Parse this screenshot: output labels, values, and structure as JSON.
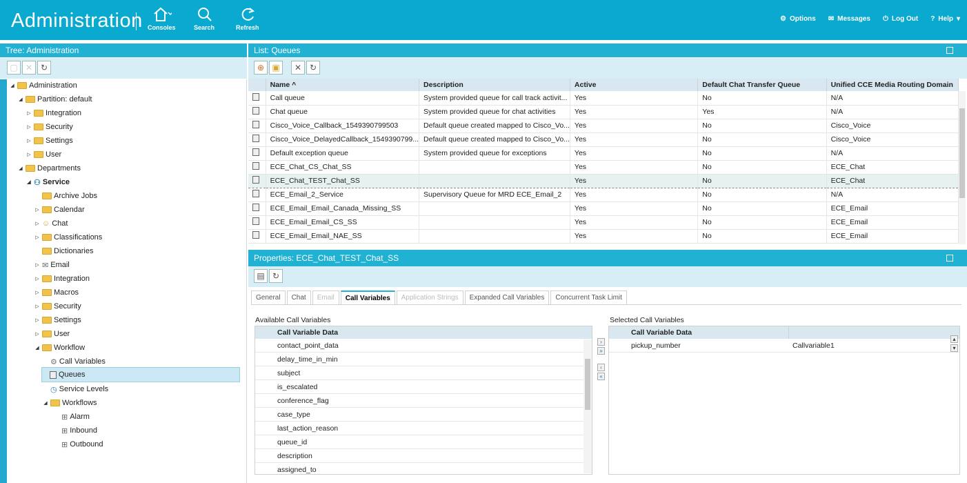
{
  "header": {
    "title": "Administration",
    "consoles": "Consoles",
    "search": "Search",
    "refresh": "Refresh",
    "options": "Options",
    "messages": "Messages",
    "logout": "Log Out",
    "help": "Help"
  },
  "tree": {
    "title": "Tree: Administration",
    "items": [
      "Administration",
      "Partition: default",
      "Integration",
      "Security",
      "Settings",
      "User",
      "Departments",
      "Service",
      "Archive Jobs",
      "Calendar",
      "Chat",
      "Classifications",
      "Dictionaries",
      "Email",
      "Integration",
      "Macros",
      "Security",
      "Settings",
      "User",
      "Workflow",
      "Call Variables",
      "Queues",
      "Service Levels",
      "Workflows",
      "Alarm",
      "Inbound",
      "Outbound"
    ]
  },
  "list": {
    "title": "List: Queues",
    "columns": [
      "Name ^",
      "Description",
      "Active",
      "Default Chat Transfer Queue",
      "Unified CCE Media Routing Domain"
    ],
    "rows": [
      [
        "Call queue",
        "System provided queue for call track activit...",
        "Yes",
        "No",
        "N/A"
      ],
      [
        "Chat queue",
        "System provided queue for chat activities",
        "Yes",
        "Yes",
        "N/A"
      ],
      [
        "Cisco_Voice_Callback_1549390799503",
        "Default queue created mapped to Cisco_Vo...",
        "Yes",
        "No",
        "Cisco_Voice"
      ],
      [
        "Cisco_Voice_DelayedCallback_1549390799...",
        "Default queue created mapped to Cisco_Vo...",
        "Yes",
        "No",
        "Cisco_Voice"
      ],
      [
        "Default exception queue",
        "System provided queue for exceptions",
        "Yes",
        "No",
        "N/A"
      ],
      [
        "ECE_Chat_CS_Chat_SS",
        "",
        "Yes",
        "No",
        "ECE_Chat"
      ],
      [
        "ECE_Chat_TEST_Chat_SS",
        "",
        "Yes",
        "No",
        "ECE_Chat"
      ],
      [
        "ECE_Email_2_Service",
        "Supervisory Queue for MRD ECE_Email_2",
        "Yes",
        "No",
        "N/A"
      ],
      [
        "ECE_Email_Email_Canada_Missing_SS",
        "",
        "Yes",
        "No",
        "ECE_Email"
      ],
      [
        "ECE_Email_Email_CS_SS",
        "",
        "Yes",
        "No",
        "ECE_Email"
      ],
      [
        "ECE_Email_Email_NAE_SS",
        "",
        "Yes",
        "No",
        "ECE_Email"
      ]
    ]
  },
  "props": {
    "title": "Properties: ECE_Chat_TEST_Chat_SS",
    "tabs": [
      "General",
      "Chat",
      "Email",
      "Call Variables",
      "Application Strings",
      "Expanded Call Variables",
      "Concurrent Task Limit"
    ],
    "available_label": "Available Call Variables",
    "selected_label": "Selected Call Variables",
    "col_header": "Call Variable Data",
    "available": [
      "contact_point_data",
      "delay_time_in_min",
      "subject",
      "is_escalated",
      "conference_flag",
      "case_type",
      "last_action_reason",
      "queue_id",
      "description",
      "assigned_to"
    ],
    "selected": [
      [
        "pickup_number",
        "Callvariable1"
      ]
    ]
  }
}
